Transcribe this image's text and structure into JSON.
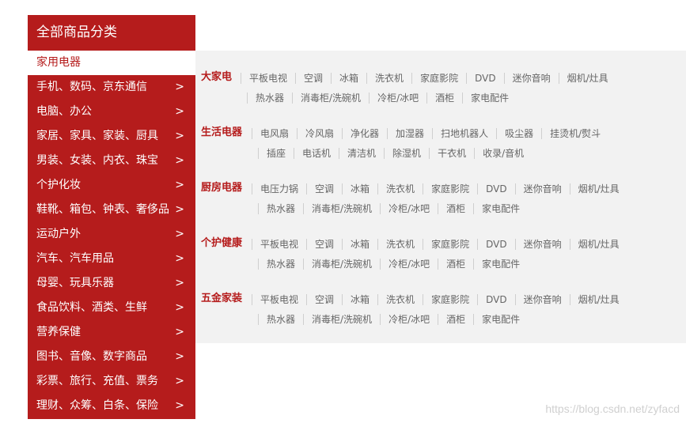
{
  "sidebar": {
    "title": "全部商品分类",
    "active_item": "家用电器",
    "items": [
      {
        "label": "手机、数码、京东通信",
        "arrow": ">"
      },
      {
        "label": "电脑、办公",
        "arrow": ">"
      },
      {
        "label": "家居、家具、家装、厨具",
        "arrow": ">"
      },
      {
        "label": "男装、女装、内衣、珠宝",
        "arrow": ">"
      },
      {
        "label": "个护化妆",
        "arrow": ">"
      },
      {
        "label": "鞋靴、箱包、钟表、奢侈品",
        "arrow": ">"
      },
      {
        "label": "运动户外",
        "arrow": ">"
      },
      {
        "label": "汽车、汽车用品",
        "arrow": ">"
      },
      {
        "label": "母婴、玩具乐器",
        "arrow": ">"
      },
      {
        "label": "食品饮料、酒类、生鲜",
        "arrow": ">"
      },
      {
        "label": "营养保健",
        "arrow": ">"
      },
      {
        "label": "图书、音像、数字商品",
        "arrow": ">"
      },
      {
        "label": "彩票、旅行、充值、票务",
        "arrow": ">"
      },
      {
        "label": "理财、众筹、白条、保险",
        "arrow": ">"
      }
    ]
  },
  "panel": {
    "groups": [
      {
        "title": "大家电",
        "row1": [
          "平板电视",
          "空调",
          "冰箱",
          "洗衣机",
          "家庭影院",
          "DVD",
          "迷你音响",
          "烟机/灶具"
        ],
        "row2": [
          "热水器",
          "消毒柜/洗碗机",
          "冷柜/冰吧",
          "酒柜",
          "家电配件"
        ]
      },
      {
        "title": "生活电器",
        "row1": [
          "电风扇",
          "冷风扇",
          "净化器",
          "加湿器",
          "扫地机器人",
          "吸尘器",
          "挂烫机/熨斗"
        ],
        "row2": [
          "插座",
          "电话机",
          "清洁机",
          "除湿机",
          "干衣机",
          "收录/音机"
        ]
      },
      {
        "title": "厨房电器",
        "row1": [
          "电压力锅",
          "空调",
          "冰箱",
          "洗衣机",
          "家庭影院",
          "DVD",
          "迷你音响",
          "烟机/灶具"
        ],
        "row2": [
          "热水器",
          "消毒柜/洗碗机",
          "冷柜/冰吧",
          "酒柜",
          "家电配件"
        ]
      },
      {
        "title": "个护健康",
        "row1": [
          "平板电视",
          "空调",
          "冰箱",
          "洗衣机",
          "家庭影院",
          "DVD",
          "迷你音响",
          "烟机/灶具"
        ],
        "row2": [
          "热水器",
          "消毒柜/洗碗机",
          "冷柜/冰吧",
          "酒柜",
          "家电配件"
        ]
      },
      {
        "title": "五金家装",
        "row1": [
          "平板电视",
          "空调",
          "冰箱",
          "洗衣机",
          "家庭影院",
          "DVD",
          "迷你音响",
          "烟机/灶具"
        ],
        "row2": [
          "热水器",
          "消毒柜/洗碗机",
          "冷柜/冰吧",
          "酒柜",
          "家电配件"
        ]
      }
    ]
  },
  "watermark": "https://blog.csdn.net/zyfacd",
  "colors": {
    "accent": "#b51c1c",
    "panel_bg": "#f2f2f2",
    "link": "#666666"
  }
}
